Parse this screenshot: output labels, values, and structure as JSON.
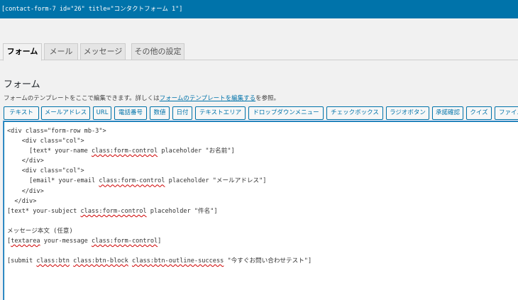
{
  "shortcode": "[contact-form-7 id=\"26\" title=\"コンタクトフォーム 1\"]",
  "tabs": [
    {
      "label": "フォーム",
      "active": true
    },
    {
      "label": "メール",
      "active": false
    },
    {
      "label": "メッセージ",
      "active": false
    },
    {
      "label": "その他の設定",
      "active": false
    }
  ],
  "form_section": {
    "title": "フォーム",
    "description_prefix": "フォームのテンプレートをここで編集できます。詳しくは",
    "description_link": "フォームのテンプレートを編集する",
    "description_suffix": "を参照。"
  },
  "tag_buttons": [
    "テキスト",
    "メールアドレス",
    "URL",
    "電話番号",
    "数値",
    "日付",
    "テキストエリア",
    "ドロップダウンメニュー",
    "チェックボックス",
    "ラジオボタン",
    "承諾確認",
    "クイズ",
    "ファイル"
  ],
  "editor": {
    "lines": [
      [
        {
          "t": "<div class=\"form-row mb-3\">"
        }
      ],
      [
        {
          "t": "    <div class=\"col\">"
        }
      ],
      [
        {
          "t": "      [text* your-name "
        },
        {
          "t": "class:form-control",
          "sq": true
        },
        {
          "t": " placeholder \"お名前\"]"
        }
      ],
      [
        {
          "t": "    </div>"
        }
      ],
      [
        {
          "t": "    <div class=\"col\">"
        }
      ],
      [
        {
          "t": "      [email* your-email "
        },
        {
          "t": "class:form-control",
          "sq": true
        },
        {
          "t": " placeholder \"メールアドレス\"]"
        }
      ],
      [
        {
          "t": "    </div>"
        }
      ],
      [
        {
          "t": "  </div>"
        }
      ],
      [
        {
          "t": "[text* your-subject "
        },
        {
          "t": "class:form-control",
          "sq": true
        },
        {
          "t": " placeholder \"件名\"]"
        }
      ],
      [
        {
          "t": ""
        }
      ],
      [
        {
          "t": "メッセージ本文 (任意)"
        }
      ],
      [
        {
          "t": "["
        },
        {
          "t": "textarea",
          "sq": true
        },
        {
          "t": " your-message "
        },
        {
          "t": "class:form-control",
          "sq": true
        },
        {
          "t": "]"
        }
      ],
      [
        {
          "t": ""
        }
      ],
      [
        {
          "t": "[submit "
        },
        {
          "t": "class:btn",
          "sq": true
        },
        {
          "t": " "
        },
        {
          "t": "class:btn-block",
          "sq": true
        },
        {
          "t": " "
        },
        {
          "t": "class:btn-outline-success",
          "sq": true
        },
        {
          "t": " \"今すぐお問い合わせテスト\"]"
        }
      ]
    ]
  }
}
